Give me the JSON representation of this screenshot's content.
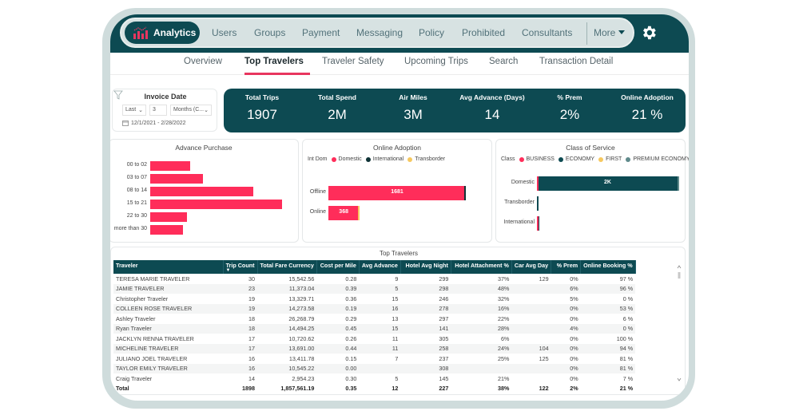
{
  "nav": {
    "brand": "Analytics",
    "items": [
      "Users",
      "Groups",
      "Payment",
      "Messaging",
      "Policy",
      "Prohibited",
      "Consultants"
    ],
    "more": "More",
    "colors": {
      "primary": "#0d4a52",
      "accent": "#e8365f",
      "pill": "#d7e2e2"
    }
  },
  "subtabs": {
    "items": [
      "Overview",
      "Top Travelers",
      "Traveler Safety",
      "Upcoming Trips",
      "Search",
      "Transaction Detail"
    ],
    "active": "Top Travelers"
  },
  "filter": {
    "title": "Invoice Date",
    "period_type": "Last",
    "period_count": "3",
    "period_unit": "Months (C...",
    "date_range": "12/1/2021 - 2/28/2022"
  },
  "kpis": [
    {
      "label": "Total Trips",
      "value": "1907"
    },
    {
      "label": "Total Spend",
      "value": "2M"
    },
    {
      "label": "Air Miles",
      "value": "3M"
    },
    {
      "label": "Avg Advance (Days)",
      "value": "14"
    },
    {
      "label": "% Prem",
      "value": "2%"
    },
    {
      "label": "Online Adoption",
      "value": "21 %"
    }
  ],
  "chart_data": [
    {
      "type": "bar",
      "orientation": "horizontal",
      "title": "Advance Purchase",
      "categories": [
        "00 to 02",
        "03 to 07",
        "08 to 14",
        "15 to 21",
        "22 to 30",
        "more than 30"
      ],
      "values": [
        255,
        335,
        655,
        840,
        235,
        210
      ],
      "xlabel": "",
      "ylabel": "",
      "color": "#ff2d5a"
    },
    {
      "type": "bar",
      "orientation": "horizontal",
      "stacked": true,
      "title": "Online Adoption",
      "legend_title": "Int Dom",
      "legend_position": "top-left",
      "categories": [
        "Offline",
        "Online"
      ],
      "series": [
        {
          "name": "Domestic",
          "color": "#ff2d5a",
          "values": [
            1681,
            368
          ]
        },
        {
          "name": "International",
          "color": "#0f3336",
          "values": [
            16,
            0
          ]
        },
        {
          "name": "Transborder",
          "color": "#f6c85f",
          "values": [
            0,
            10
          ]
        }
      ],
      "data_labels": [
        "1681",
        "368"
      ]
    },
    {
      "type": "bar",
      "orientation": "horizontal",
      "stacked": true,
      "title": "Class of Service",
      "legend_title": "Class",
      "legend_position": "top-left",
      "categories": [
        "Domestic",
        "Transborder",
        "International"
      ],
      "series": [
        {
          "name": "BUSINESS",
          "color": "#ff2d5a",
          "values": [
            5,
            0,
            1
          ]
        },
        {
          "name": "ECONOMY",
          "color": "#0d4a52",
          "values": [
            1990,
            10,
            10
          ]
        },
        {
          "name": "FIRST",
          "color": "#f6c85f",
          "values": [
            0,
            0,
            0
          ]
        },
        {
          "name": "PREMIUM ECONOMY",
          "color": "#5f8a8b",
          "values": [
            20,
            0,
            0
          ]
        }
      ],
      "data_labels": [
        "2K",
        "",
        ""
      ]
    }
  ],
  "table": {
    "title": "Top Travelers",
    "columns": [
      "Traveler",
      "Trip Count",
      "Total Fare Currency",
      "Cost per Mile",
      "Avg Advance",
      "Hotel Avg Night",
      "Hotel Attachment %",
      "Car Avg Day",
      "% Prem",
      "Online Booking %"
    ],
    "sort_column": "Trip Count",
    "rows": [
      [
        "TERESA MARIE TRAVELER",
        "30",
        "15,542.56",
        "0.28",
        "9",
        "299",
        "37%",
        "129",
        "0%",
        "97 %"
      ],
      [
        "JAMIE TRAVELER",
        "23",
        "11,373.04",
        "0.39",
        "5",
        "298",
        "48%",
        "",
        "6%",
        "96 %"
      ],
      [
        "Christopher Traveler",
        "19",
        "13,329.71",
        "0.36",
        "15",
        "246",
        "32%",
        "",
        "5%",
        "0 %"
      ],
      [
        "COLLEEN ROSE TRAVELER",
        "19",
        "14,273.58",
        "0.19",
        "16",
        "278",
        "16%",
        "",
        "0%",
        "53 %"
      ],
      [
        "Ashley Traveler",
        "18",
        "26,268.79",
        "0.29",
        "13",
        "297",
        "22%",
        "",
        "0%",
        "6 %"
      ],
      [
        "Ryan Traveler",
        "18",
        "14,494.25",
        "0.45",
        "15",
        "141",
        "28%",
        "",
        "4%",
        "0 %"
      ],
      [
        "JACKLYN RENNA TRAVELER",
        "17",
        "10,720.62",
        "0.26",
        "11",
        "305",
        "6%",
        "",
        "0%",
        "100 %"
      ],
      [
        "MICHELINE TRAVELER",
        "17",
        "13,691.00",
        "0.44",
        "11",
        "258",
        "24%",
        "104",
        "0%",
        "94 %"
      ],
      [
        "JULIANO JOEL TRAVELER",
        "16",
        "13,411.78",
        "0.15",
        "7",
        "237",
        "25%",
        "125",
        "0%",
        "81 %"
      ],
      [
        "TAYLOR EMILY TRAVELER",
        "16",
        "10,545.22",
        "0.00",
        "",
        "308",
        "",
        "",
        "0%",
        "81 %"
      ],
      [
        "Craig Traveler",
        "14",
        "2,954.23",
        "0.30",
        "5",
        "145",
        "21%",
        "",
        "0%",
        "7 %"
      ]
    ],
    "total": [
      "Total",
      "1898",
      "1,857,561.19",
      "0.35",
      "12",
      "227",
      "38%",
      "122",
      "2%",
      "21 %"
    ]
  }
}
